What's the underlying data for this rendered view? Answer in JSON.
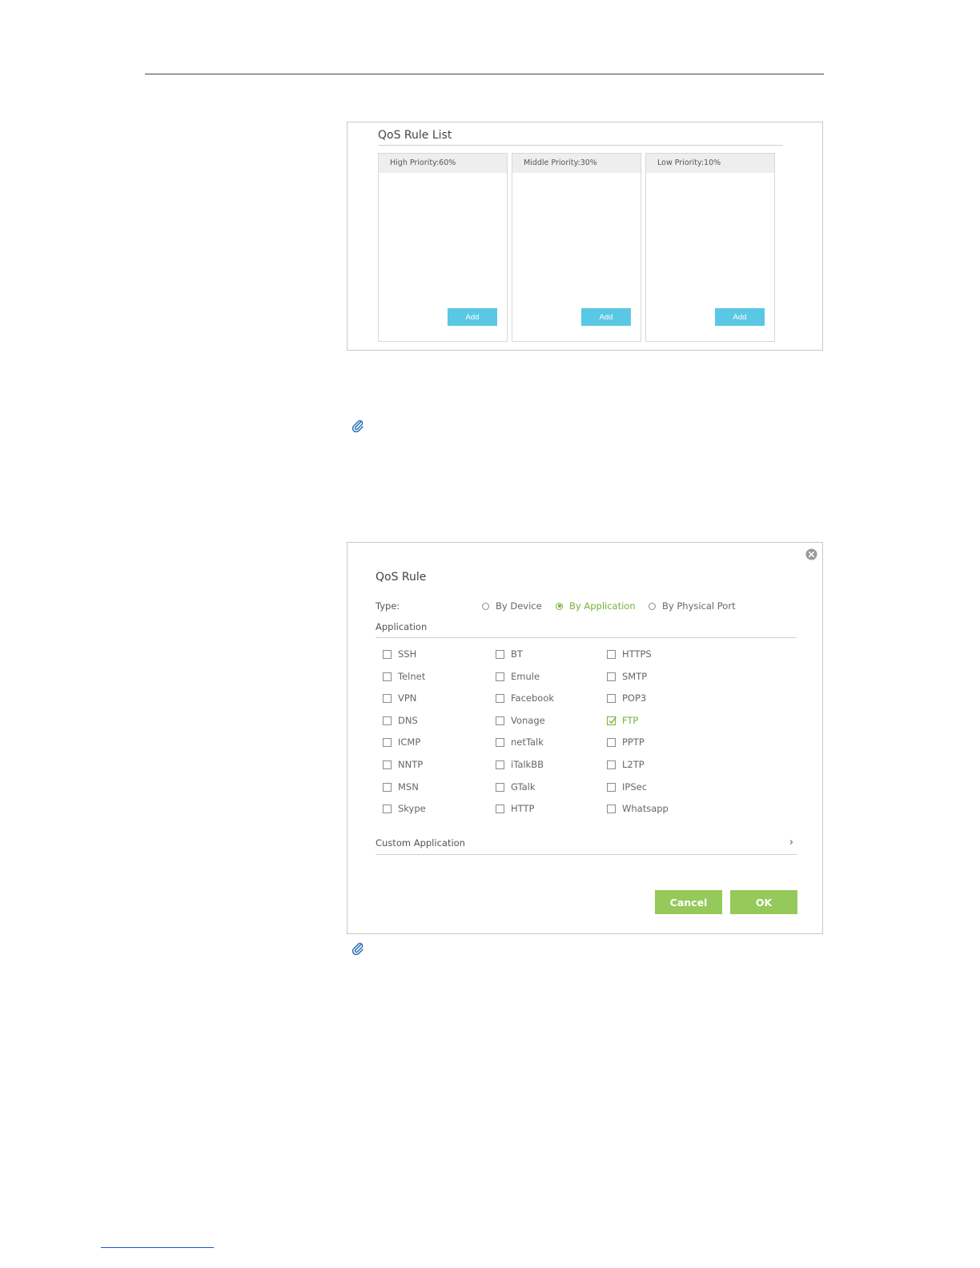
{
  "rule_list": {
    "title": "QoS Rule List",
    "columns": [
      {
        "label": "High Priority:60%",
        "add_label": "Add"
      },
      {
        "label": "Middle Priority:30%",
        "add_label": "Add"
      },
      {
        "label": "Low Priority:10%",
        "add_label": "Add"
      }
    ]
  },
  "dialog": {
    "title": "QoS Rule",
    "type_label": "Type:",
    "types": [
      {
        "label": "By Device",
        "selected": false
      },
      {
        "label": "By Application",
        "selected": true
      },
      {
        "label": "By Physical Port",
        "selected": false
      }
    ],
    "application_label": "Application",
    "applications": [
      [
        {
          "label": "SSH"
        },
        {
          "label": "BT"
        },
        {
          "label": "HTTPS"
        }
      ],
      [
        {
          "label": "Telnet"
        },
        {
          "label": "Emule"
        },
        {
          "label": "SMTP"
        }
      ],
      [
        {
          "label": "VPN"
        },
        {
          "label": "Facebook"
        },
        {
          "label": "POP3"
        }
      ],
      [
        {
          "label": "DNS"
        },
        {
          "label": "Vonage"
        },
        {
          "label": "FTP",
          "checked": true
        }
      ],
      [
        {
          "label": "ICMP"
        },
        {
          "label": "netTalk"
        },
        {
          "label": "PPTP"
        }
      ],
      [
        {
          "label": "NNTP"
        },
        {
          "label": "iTalkBB"
        },
        {
          "label": "L2TP"
        }
      ],
      [
        {
          "label": "MSN"
        },
        {
          "label": "GTalk"
        },
        {
          "label": "IPSec"
        }
      ],
      [
        {
          "label": "Skype"
        },
        {
          "label": "HTTP"
        },
        {
          "label": "Whatsapp"
        }
      ]
    ],
    "custom_application_label": "Custom Application",
    "cancel_label": "Cancel",
    "ok_label": "OK"
  },
  "colors": {
    "accent_green": "#74b23a",
    "button_green": "#95c95a",
    "add_button_blue": "#5ac8e4",
    "note_icon_blue": "#2a6fb5"
  }
}
